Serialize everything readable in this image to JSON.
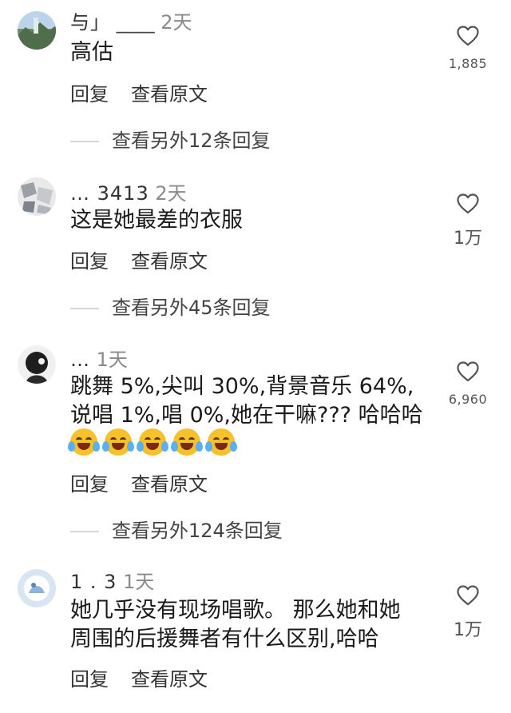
{
  "comments": [
    {
      "username": "与」",
      "time": "2天",
      "text": "高估",
      "likes": "1,885",
      "reply_label": "回复",
      "original_label": "查看原文",
      "more_replies": "查看另外12条回复"
    },
    {
      "username": "… 3413",
      "time": "2天",
      "text": "这是她最差的衣服",
      "likes": "1万",
      "reply_label": "回复",
      "original_label": "查看原文",
      "more_replies": "查看另外45条回复"
    },
    {
      "username": "…",
      "time": "1天",
      "text": "跳舞 5%,尖叫 30%,背景音乐 64%,\n说唱 1%,唱 0%,她在干嘛??? 哈哈哈",
      "emoji_icon": "joy-tears-emoji",
      "likes": "6,960",
      "reply_label": "回复",
      "original_label": "查看原文",
      "more_replies": "查看另外124条回复"
    },
    {
      "username": "1 . 3",
      "time": "1天",
      "text": "她几乎没有现场唱歌。 那么她和她\n周围的后援舞者有什么区别,哈哈",
      "likes": "1万",
      "reply_label": "回复",
      "original_label": "查看原文"
    }
  ],
  "colors": {
    "heart_outline": "#555555",
    "meta_gray": "#8a8a8a",
    "emoji_yellow": "#f6c12c"
  },
  "icons": {
    "like": "heart-outline-icon"
  }
}
